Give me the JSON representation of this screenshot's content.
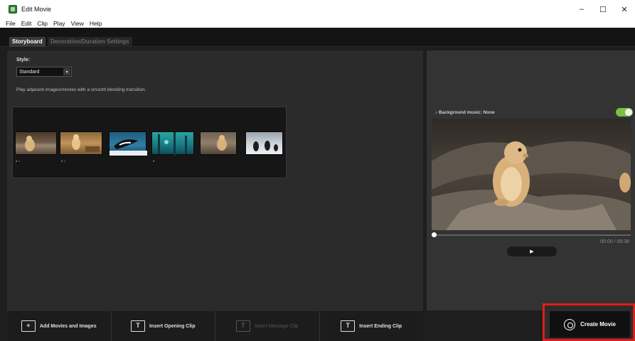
{
  "window": {
    "title": "Edit Movie",
    "minimize": "–",
    "maximize": "☐",
    "close": "✕"
  },
  "menu": [
    "File",
    "Edit",
    "Clip",
    "Play",
    "View",
    "Help"
  ],
  "tabs": {
    "storyboard": "Storyboard",
    "decoration": "Decoration/Duration Settings"
  },
  "style": {
    "label": "Style:",
    "selected": "Standard",
    "caret": "▾",
    "description": "Play adjacent images/movies with a smooth blending transition."
  },
  "clip_icons": [
    "▪▫",
    "▪▫",
    "▪"
  ],
  "bottom_buttons": [
    {
      "label": "Add Movies and Images",
      "icon": "add-media-icon",
      "glyph": "+",
      "enabled": true
    },
    {
      "label": "Insert Opening Clip",
      "icon": "opening-clip-icon",
      "glyph": "T",
      "enabled": true
    },
    {
      "label": "Insert Message Clip",
      "icon": "message-clip-icon",
      "glyph": "T",
      "enabled": false
    },
    {
      "label": "Insert Ending Clip",
      "icon": "ending-clip-icon",
      "glyph": "T",
      "enabled": true
    }
  ],
  "preview": {
    "music": "♪ Background music: None",
    "time": "00:00 / 00:38",
    "play": "▶",
    "progress": 0
  },
  "create": {
    "label": "Create Movie"
  },
  "colors": {
    "accent_toggle": "#7ac143",
    "highlight_box": "#e21b1b"
  }
}
